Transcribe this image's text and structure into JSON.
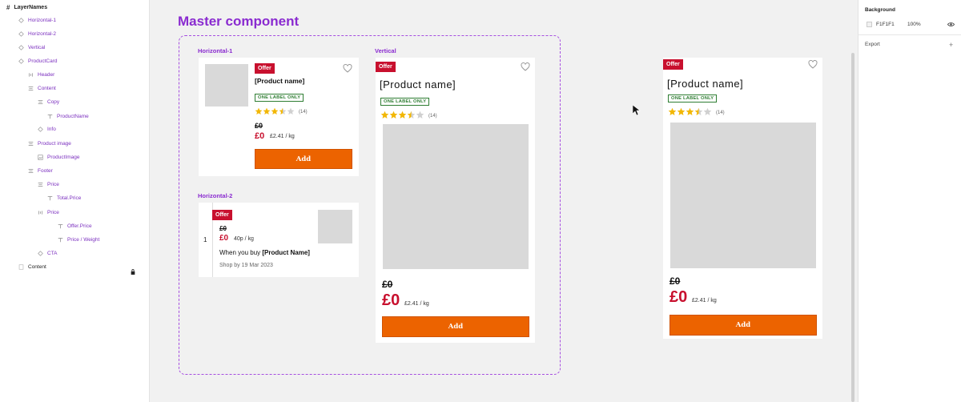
{
  "layers": {
    "title": "LayerNames",
    "items": [
      {
        "label": "Horizontal-1",
        "icon": "component-instance-icon"
      },
      {
        "label": "Horizontal-2",
        "icon": "component-instance-icon"
      },
      {
        "label": "Vertical",
        "icon": "component-instance-icon"
      },
      {
        "label": "ProductCard",
        "icon": "component-instance-icon"
      },
      {
        "label": "Header",
        "icon": "auto-layout-horizontal-icon"
      },
      {
        "label": "Content",
        "icon": "auto-layout-vertical-icon"
      },
      {
        "label": "Copy",
        "icon": "auto-layout-vertical-icon"
      },
      {
        "label": "ProductName",
        "icon": "text-icon"
      },
      {
        "label": "Info",
        "icon": "component-instance-icon"
      },
      {
        "label": "Product image",
        "icon": "auto-layout-vertical-icon"
      },
      {
        "label": "ProductImage",
        "icon": "image-icon"
      },
      {
        "label": "Footer",
        "icon": "auto-layout-vertical-icon"
      },
      {
        "label": "Price",
        "icon": "auto-layout-vertical-icon"
      },
      {
        "label": "Total.Price",
        "icon": "text-icon"
      },
      {
        "label": "Price",
        "icon": "auto-layout-horizontal-icon"
      },
      {
        "label": "Offer.Price",
        "icon": "text-icon"
      },
      {
        "label": "Price / Weight",
        "icon": "text-icon"
      },
      {
        "label": "CTA",
        "icon": "component-instance-icon"
      },
      {
        "label": "Content",
        "icon": "page-icon"
      }
    ]
  },
  "canvas": {
    "title": "Master component",
    "frame_labels": {
      "horizontal1": "Horizontal-1",
      "horizontal2": "Horizontal-2",
      "vertical": "Vertical"
    }
  },
  "card": {
    "offer": "Offer",
    "product_name": "[Product name]",
    "label": "ONE LABEL ONLY",
    "rating_count": "(14)",
    "rating": 3.5,
    "was_price": "£0",
    "price": "£0",
    "per_weight": "£2.41 / kg",
    "add": "Add"
  },
  "card_h2": {
    "offer": "Offer",
    "index": "1",
    "was_price": "£0",
    "price": "£0",
    "per_weight": "40p / kg",
    "promo_prefix": "When you buy ",
    "promo_bold": "[Product Name]",
    "shop_by": "Shop by 19 Mar 2023"
  },
  "properties": {
    "background_title": "Background",
    "background_hex": "F1F1F1",
    "background_opacity": "100%",
    "export_label": "Export"
  },
  "colors": {
    "offer": "#c8102e",
    "add": "#ec6300",
    "accent": "#8a2bd0",
    "star": "#f2b705",
    "label_green": "#2e7d32"
  }
}
